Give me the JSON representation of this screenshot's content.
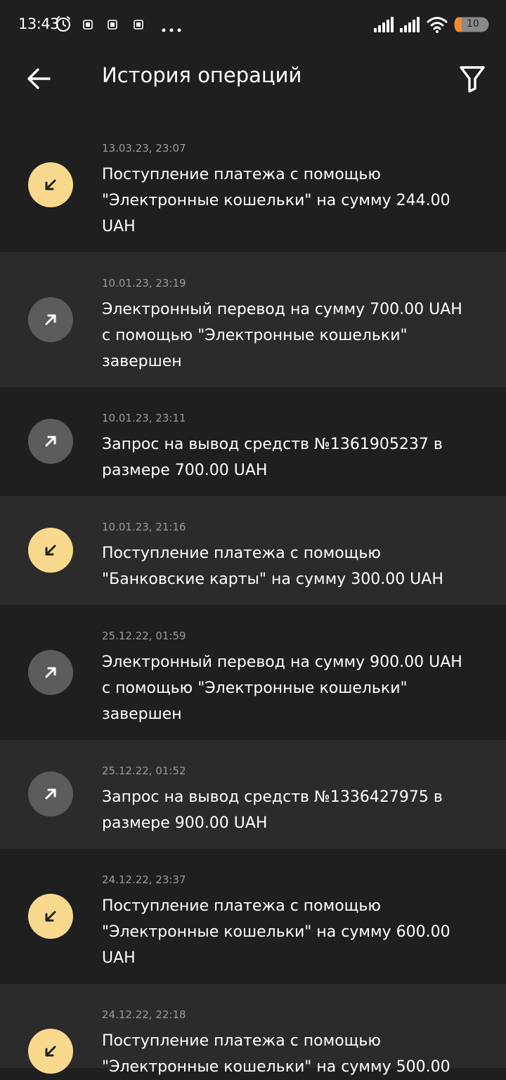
{
  "status_bar": {
    "time": "13:43",
    "battery": "10",
    "icons": [
      "alarm-icon",
      "notification-icon",
      "notification-icon",
      "notification-icon",
      "more-dots-icon",
      "signal-icon",
      "signal-icon",
      "wifi-icon",
      "battery-icon"
    ]
  },
  "header": {
    "title": "История операций",
    "back_icon": "arrow-left-icon",
    "filter_icon": "filter-icon"
  },
  "colors": {
    "incoming": "#f8d98d",
    "outgoing": "#5c5c5c",
    "row_alt": "#2b2b2b",
    "background": "#1f1f1f"
  },
  "operations": [
    {
      "date": "13.03.23, 23:07",
      "text": "Поступление платежа с помощью \"Электронные кошельки\" на сумму 244.00 UAH",
      "direction": "in",
      "icon": "arrow-down-left-icon"
    },
    {
      "date": "10.01.23, 23:19",
      "text": "Электронный перевод на сумму 700.00 UAH с помощью \"Электронные кошельки\" завершен",
      "direction": "out",
      "icon": "arrow-up-right-icon"
    },
    {
      "date": "10.01.23, 23:11",
      "text": "Запрос на вывод средств №1361905237 в размере 700.00 UAH",
      "direction": "out",
      "icon": "arrow-up-right-icon"
    },
    {
      "date": "10.01.23, 21:16",
      "text": "Поступление платежа с помощью \"Банковские карты\" на сумму 300.00 UAH",
      "direction": "in",
      "icon": "arrow-down-left-icon"
    },
    {
      "date": "25.12.22, 01:59",
      "text": "Электронный перевод на сумму 900.00 UAH с помощью \"Электронные кошельки\" завершен",
      "direction": "out",
      "icon": "arrow-up-right-icon"
    },
    {
      "date": "25.12.22, 01:52",
      "text": "Запрос на вывод средств №1336427975 в размере 900.00 UAH",
      "direction": "out",
      "icon": "arrow-up-right-icon"
    },
    {
      "date": "24.12.22, 23:37",
      "text": "Поступление платежа с помощью \"Электронные кошельки\" на сумму 600.00 UAH",
      "direction": "in",
      "icon": "arrow-down-left-icon"
    },
    {
      "date": "24.12.22, 22:18",
      "text": "Поступление платежа с помощью \"Электронные кошельки\" на сумму 500.00",
      "direction": "in",
      "icon": "arrow-down-left-icon"
    }
  ]
}
